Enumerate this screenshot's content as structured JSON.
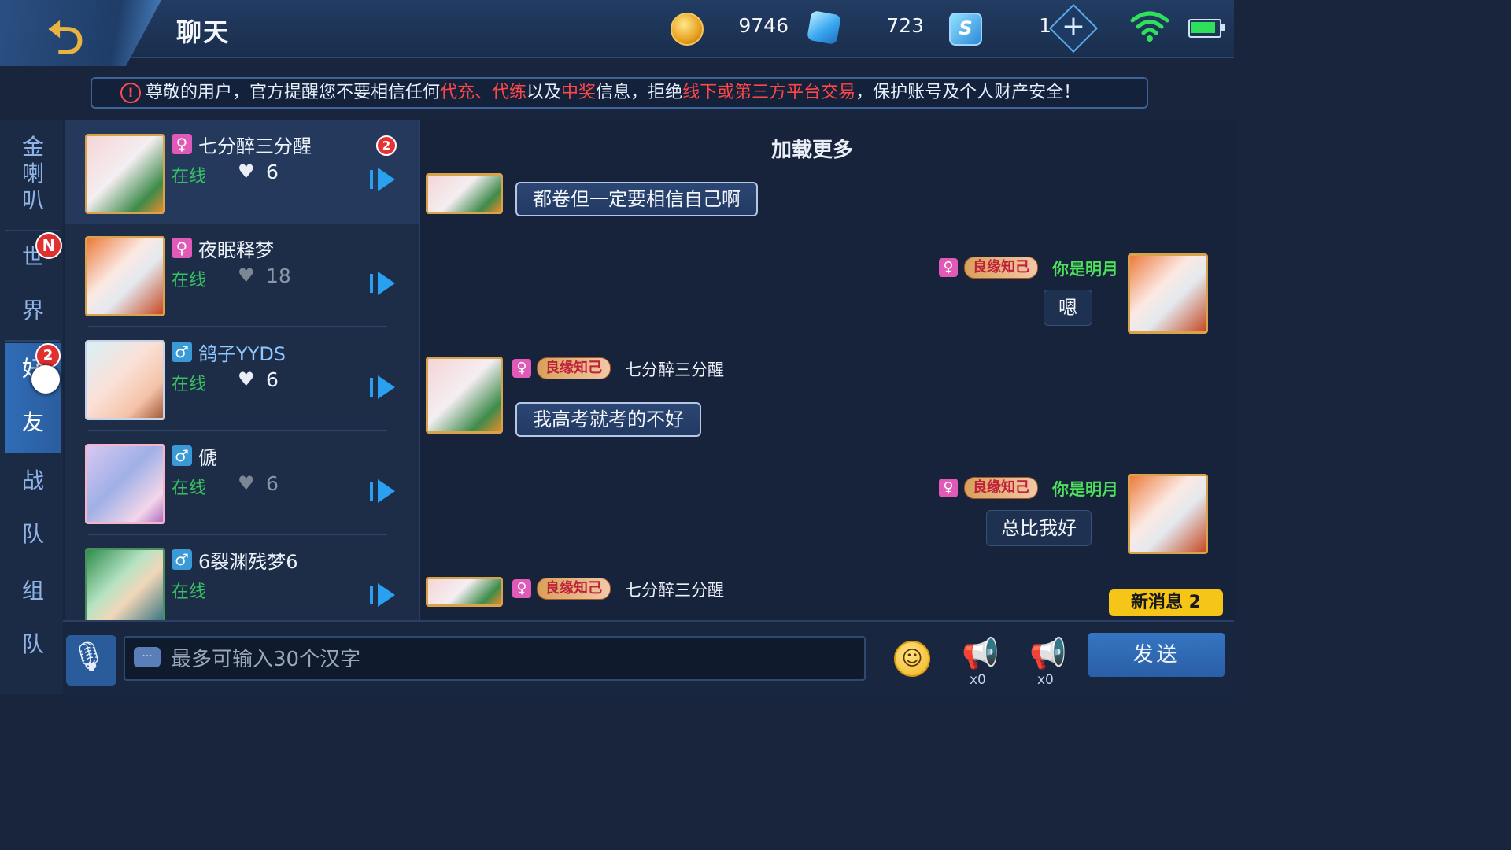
{
  "header": {
    "title": "聊天",
    "gold": "9746",
    "diamonds": "723",
    "tokens": "1",
    "token_glyph": "S",
    "plus_glyph": "+"
  },
  "notice": {
    "icon": "!",
    "parts": [
      "尊敬的用户，官方提醒您不要相信任何",
      "代充、代练",
      "以及",
      "中奖",
      "信息，拒绝",
      "线下或第三方平台交易",
      "，保护账号及个人财产安全！"
    ]
  },
  "side_tabs": {
    "tab1": [
      "金",
      "喇",
      "叭"
    ],
    "tab2": [
      "世",
      "界"
    ],
    "tab3": [
      "好",
      "友"
    ],
    "tab4": [
      "战",
      "队"
    ],
    "tab5": [
      "组",
      "队"
    ],
    "world_badge": "N",
    "friends_badge": "2"
  },
  "friends": [
    {
      "name": "七分醉三分醒",
      "gender": "♀",
      "status": "在线",
      "intimacy": "6",
      "unread": "2"
    },
    {
      "name": "夜眠释梦",
      "gender": "♀",
      "status": "在线",
      "intimacy": "18"
    },
    {
      "name": "鸽子YYDS",
      "gender": "♂",
      "status": "在线",
      "intimacy": "6"
    },
    {
      "name": "傂",
      "gender": "♂",
      "status": "在线",
      "intimacy": "6"
    },
    {
      "name": "6裂渊残梦6",
      "gender": "♂",
      "status": "在线"
    }
  ],
  "chat": {
    "load_more": "加载更多",
    "relation_tag": "良缘知己",
    "messages": [
      {
        "side": "left",
        "text": "都卷但一定要相信自己啊"
      },
      {
        "side": "right",
        "sender": "你是明月",
        "text": "嗯"
      },
      {
        "side": "left",
        "sender": "七分醉三分醒",
        "text": "我高考就考的不好"
      },
      {
        "side": "right",
        "sender": "你是明月",
        "text": "总比我好"
      },
      {
        "side": "left",
        "sender": "七分醉三分醒"
      }
    ],
    "new_messages": "新消息 2"
  },
  "input": {
    "placeholder": "最多可输入30个汉字",
    "horn1_count": "x0",
    "horn2_count": "x0",
    "send_label": "发送"
  },
  "icons": {
    "back": "back-arrow-icon",
    "gold": "gold-coin-icon",
    "diamond": "diamond-icon",
    "token": "token-icon",
    "wifi": "wifi-icon",
    "battery": "battery-icon",
    "voice": "voice-icon",
    "emoji": "emoji-icon",
    "horn": "horn-icon"
  },
  "colors": {
    "online": "#36c25e",
    "warning": "#ff4747",
    "accent": "#2aa0f0",
    "new_message": "#f5c518"
  }
}
